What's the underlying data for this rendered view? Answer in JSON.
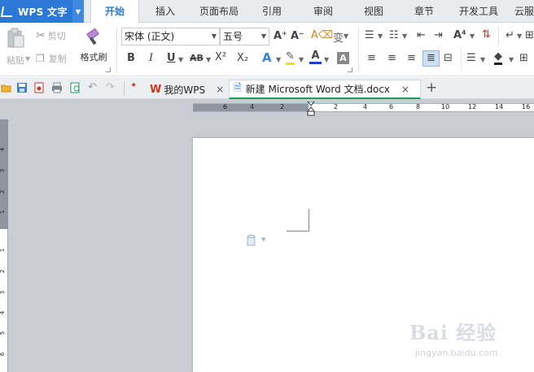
{
  "app": {
    "name": "WPS 文字"
  },
  "menu_tabs": [
    "开始",
    "插入",
    "页面布局",
    "引用",
    "审阅",
    "视图",
    "章节",
    "开发工具",
    "云服"
  ],
  "ribbon": {
    "paste_label": "粘贴",
    "cut_label": "剪切",
    "copy_label": "复制",
    "format_painter_label": "格式刷",
    "font_name": "宋体 (正文)",
    "font_size": "五号",
    "bold": "B",
    "italic": "I",
    "underline": "U",
    "strikethrough": "AB",
    "superscript": "X²",
    "subscript": "X₂"
  },
  "doc_tabs": {
    "home_label": "我的WPS",
    "active_label": "新建 Microsoft Word 文档.docx"
  },
  "ruler": {
    "h_labels": [
      "6",
      "4",
      "2",
      "2",
      "4",
      "6",
      "8",
      "10",
      "12",
      "14",
      "16"
    ],
    "v_labels": [
      "4",
      "3",
      "2",
      "1",
      "1",
      "2",
      "3",
      "4",
      "5",
      "6"
    ]
  },
  "watermark": {
    "main": "Bai 经验",
    "sub": "jingyan.baidu.com"
  },
  "colors": {
    "accent": "#2b78d6",
    "active_tab_line": "#1e9e5e",
    "workspace": "#c9ccd3"
  }
}
